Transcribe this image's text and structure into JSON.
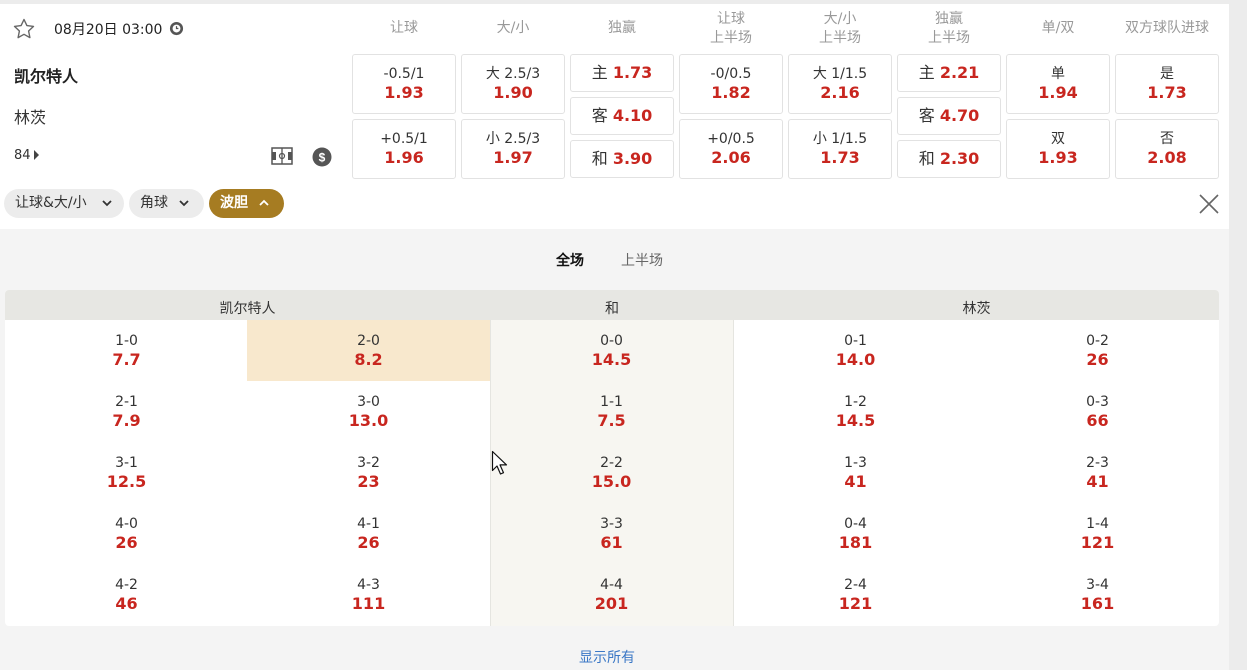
{
  "match": {
    "datetime": "08月20日 03:00",
    "home": "凯尔特人",
    "away": "林茨",
    "more_count": "84"
  },
  "columns": [
    "让球",
    "大/小",
    "独赢",
    "让球\n上半场",
    "大/小\n上半场",
    "独赢\n上半场",
    "单/双",
    "双方球队进球"
  ],
  "odds": {
    "handicap": [
      {
        "label": "-0.5/1",
        "odd": "1.93"
      },
      {
        "label": "+0.5/1",
        "odd": "1.96"
      }
    ],
    "overunder": [
      {
        "label": "大 2.5/3",
        "odd": "1.90"
      },
      {
        "label": "小 2.5/3",
        "odd": "1.97"
      }
    ],
    "moneyline": [
      {
        "label": "主",
        "odd": "1.73"
      },
      {
        "label": "客",
        "odd": "4.10"
      },
      {
        "label": "和",
        "odd": "3.90"
      }
    ],
    "handicap_1h": [
      {
        "label": "-0/0.5",
        "odd": "1.82"
      },
      {
        "label": "+0/0.5",
        "odd": "2.06"
      }
    ],
    "overunder_1h": [
      {
        "label": "大 1/1.5",
        "odd": "2.16"
      },
      {
        "label": "小 1/1.5",
        "odd": "1.73"
      }
    ],
    "moneyline_1h": [
      {
        "label": "主",
        "odd": "2.21"
      },
      {
        "label": "客",
        "odd": "4.70"
      },
      {
        "label": "和",
        "odd": "2.30"
      }
    ],
    "oddeven": [
      {
        "label": "单",
        "odd": "1.94"
      },
      {
        "label": "双",
        "odd": "1.93"
      }
    ],
    "btts": [
      {
        "label": "是",
        "odd": "1.73"
      },
      {
        "label": "否",
        "odd": "2.08"
      }
    ]
  },
  "filters": [
    {
      "label": "让球&大/小",
      "active": false
    },
    {
      "label": "角球",
      "active": false
    },
    {
      "label": "波胆",
      "active": true
    }
  ],
  "correct_score": {
    "tabs": {
      "full": "全场",
      "half": "上半场"
    },
    "headers": {
      "home": "凯尔特人",
      "draw": "和",
      "away": "林茨"
    },
    "columns": [
      [
        {
          "s": "1-0",
          "o": "7.7"
        },
        {
          "s": "2-1",
          "o": "7.9"
        },
        {
          "s": "3-1",
          "o": "12.5"
        },
        {
          "s": "4-0",
          "o": "26"
        },
        {
          "s": "4-2",
          "o": "46"
        }
      ],
      [
        {
          "s": "2-0",
          "o": "8.2"
        },
        {
          "s": "3-0",
          "o": "13.0"
        },
        {
          "s": "3-2",
          "o": "23"
        },
        {
          "s": "4-1",
          "o": "26"
        },
        {
          "s": "4-3",
          "o": "111"
        }
      ],
      [
        {
          "s": "0-0",
          "o": "14.5"
        },
        {
          "s": "1-1",
          "o": "7.5"
        },
        {
          "s": "2-2",
          "o": "15.0"
        },
        {
          "s": "3-3",
          "o": "61"
        },
        {
          "s": "4-4",
          "o": "201"
        }
      ],
      [
        {
          "s": "0-1",
          "o": "14.0"
        },
        {
          "s": "1-2",
          "o": "14.5"
        },
        {
          "s": "1-3",
          "o": "41"
        },
        {
          "s": "0-4",
          "o": "181"
        },
        {
          "s": "2-4",
          "o": "121"
        }
      ],
      [
        {
          "s": "0-2",
          "o": "26"
        },
        {
          "s": "0-3",
          "o": "66"
        },
        {
          "s": "2-3",
          "o": "41"
        },
        {
          "s": "1-4",
          "o": "121"
        },
        {
          "s": "3-4",
          "o": "161"
        }
      ]
    ],
    "selected": "2-0",
    "show_all": "显示所有"
  },
  "colors": {
    "odd_red": "#c8261f",
    "active_gold": "#a67c22",
    "selected_bg": "#f8e8cd",
    "link_blue": "#3b78c6"
  }
}
